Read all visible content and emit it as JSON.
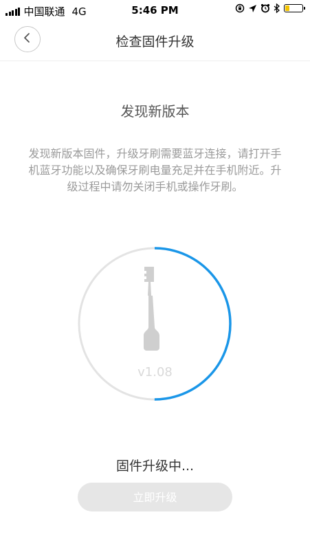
{
  "status_bar": {
    "carrier": "中国联通",
    "network": "4G",
    "time": "5:46 PM",
    "battery_level": 0.25,
    "icons": [
      "screen-rotation-lock-icon",
      "location-arrow-icon",
      "alarm-icon",
      "bluetooth-icon",
      "battery-icon"
    ]
  },
  "nav": {
    "title": "检查固件升级",
    "back_icon": "chevron-left-icon"
  },
  "content": {
    "heading": "发现新版本",
    "description": "发现新版本固件，升级牙刷需要蓝牙连接，请打开手机蓝牙功能以及确保牙刷电量充足并在手机附近。升级过程中请勿关闭手机或操作牙刷。",
    "version": "v1.08",
    "progress": 0.5,
    "progress_color": "#1a96e8",
    "track_color": "#e3e3e3",
    "status": "固件升级中...",
    "button_label": "立即升级"
  }
}
